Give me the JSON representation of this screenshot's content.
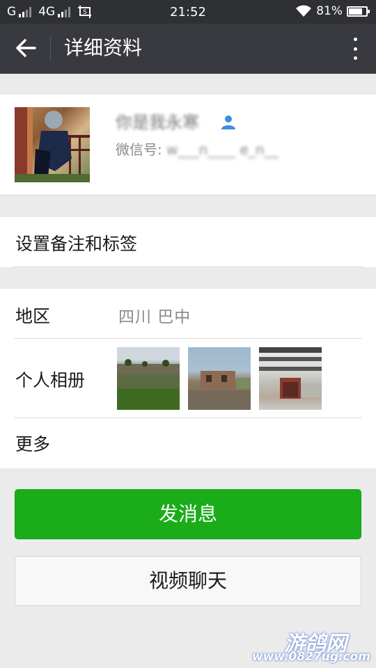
{
  "status_bar": {
    "carrier1": "G",
    "carrier2": "4G",
    "time": "21:52",
    "battery_pct": "81%",
    "battery_level": 0.81
  },
  "header": {
    "title": "详细资料"
  },
  "profile": {
    "name": "你是我永寒",
    "wechat_id_label": "微信号:",
    "wechat_id_value": "w___n____ e_n__"
  },
  "remark": {
    "label": "设置备注和标签"
  },
  "info": {
    "region_label": "地区",
    "region_value": "四川  巴中",
    "album_label": "个人相册",
    "more_label": "更多"
  },
  "actions": {
    "send_message": "发消息",
    "video_chat": "视频聊天"
  },
  "watermark": {
    "brand": "游鸽网",
    "url": "www.0827ug.com"
  },
  "colors": {
    "header_bg": "#393a3f",
    "accent_green": "#1aad19",
    "page_bg": "#ebebeb"
  }
}
